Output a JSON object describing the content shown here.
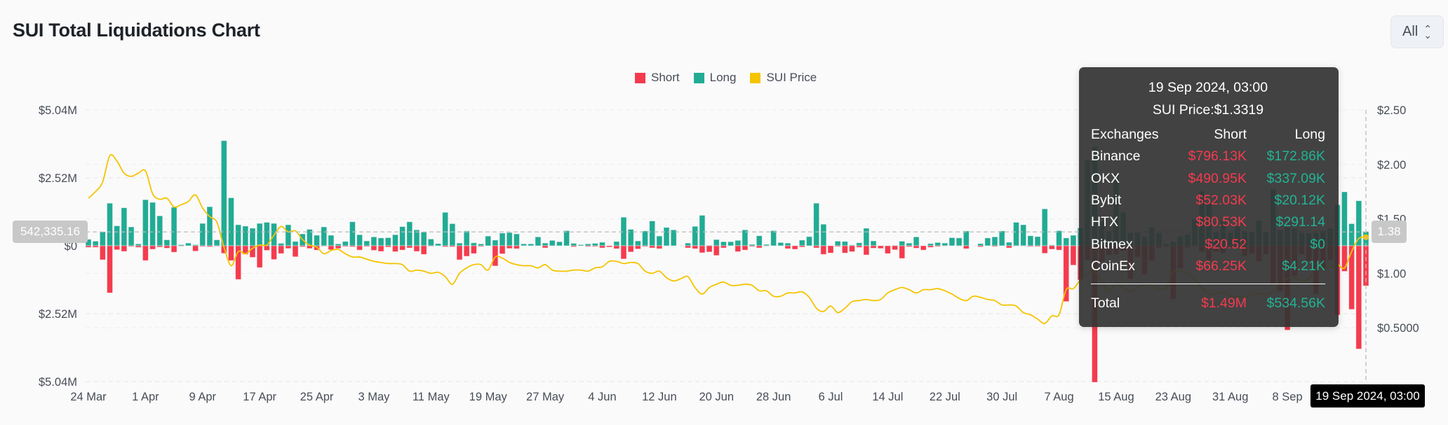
{
  "header": {
    "title": "SUI Total Liquidations Chart",
    "range_select": "All"
  },
  "legend": [
    {
      "label": "Short",
      "color": "#f43b4e"
    },
    {
      "label": "Long",
      "color": "#22ab94"
    },
    {
      "label": "SUI Price",
      "color": "#f5c400"
    }
  ],
  "tooltip": {
    "date": "19 Sep 2024, 03:00",
    "price": "SUI Price:$1.3319",
    "columns": [
      "Exchanges",
      "Short",
      "Long"
    ],
    "rows": [
      {
        "exchange": "Binance",
        "short": "$796.13K",
        "long": "$172.86K"
      },
      {
        "exchange": "OKX",
        "short": "$490.95K",
        "long": "$337.09K"
      },
      {
        "exchange": "Bybit",
        "short": "$52.03K",
        "long": "$20.12K"
      },
      {
        "exchange": "HTX",
        "short": "$80.53K",
        "long": "$291.14"
      },
      {
        "exchange": "Bitmex",
        "short": "$20.52",
        "long": "$0"
      },
      {
        "exchange": "CoinEx",
        "short": "$66.25K",
        "long": "$4.21K"
      }
    ],
    "total": {
      "label": "Total",
      "short": "$1.49M",
      "long": "$534.56K"
    }
  },
  "crosshair": {
    "left_value": "542,335.16",
    "right_value": "1.38",
    "date_label": "19 Sep 2024, 03:00"
  },
  "chart_data": {
    "type": "bar",
    "title": "SUI Total Liquidations Chart",
    "x": {
      "start": "2024-03-24",
      "end": "2024-09-19",
      "step": "1 day"
    },
    "x_tick_labels": [
      "24 Mar",
      "1 Apr",
      "9 Apr",
      "17 Apr",
      "25 Apr",
      "3 May",
      "11 May",
      "19 May",
      "27 May",
      "4 Jun",
      "12 Jun",
      "20 Jun",
      "28 Jun",
      "6 Jul",
      "14 Jul",
      "22 Jul",
      "30 Jul",
      "7 Aug",
      "15 Aug",
      "23 Aug",
      "31 Aug",
      "8 Sep"
    ],
    "y_left": {
      "unit": "USD millions",
      "range": [
        -5.04,
        5.04
      ],
      "ticks": [
        5.04,
        2.52,
        0,
        -2.52,
        -5.04
      ],
      "tick_labels": [
        "$5.04M",
        "$2.52M",
        "$0",
        "$2.52M",
        "$5.04M"
      ]
    },
    "y_right": {
      "unit": "USD",
      "range": [
        0,
        2.5
      ],
      "ticks": [
        2.5,
        2.0,
        1.5,
        1.0,
        0.5
      ],
      "tick_labels": [
        "$2.50",
        "$2.00",
        "$1.50",
        "$1.00",
        "$0.5000"
      ]
    },
    "grid": true,
    "legend_position": "top-center",
    "series": [
      {
        "name": "Short",
        "type": "bar",
        "direction": "down",
        "color": "#f43b4e",
        "values": [
          0.06,
          0.06,
          0.52,
          1.75,
          0.15,
          0.21,
          0.03,
          0.06,
          0.55,
          0.13,
          0.05,
          0.09,
          0.24,
          0.02,
          0.0,
          0.2,
          0.03,
          0.04,
          0.02,
          0.28,
          0.55,
          1.25,
          0.32,
          0.43,
          0.81,
          0.17,
          0.51,
          0.29,
          0.1,
          0.41,
          0.04,
          0.1,
          0.16,
          0.02,
          0.15,
          0.1,
          0.03,
          0.04,
          0.16,
          0.03,
          0.17,
          0.21,
          0.05,
          0.22,
          0.16,
          0.08,
          0.21,
          0.32,
          0.02,
          0.0,
          0.04,
          0.04,
          0.52,
          0.39,
          0.29,
          0.03,
          0.0,
          0.75,
          0.3,
          0.1,
          0.11,
          0.0,
          0.0,
          0.0,
          0.08,
          0.0,
          0.0,
          0.0,
          0.04,
          0.0,
          0.03,
          0.03,
          0.08,
          0.05,
          0.11,
          0.49,
          0.23,
          0.12,
          0.03,
          0.08,
          0.11,
          0.0,
          0.0,
          0.0,
          0.08,
          0.11,
          0.26,
          0.23,
          0.36,
          0.08,
          0.0,
          0.22,
          0.16,
          0.03,
          0.08,
          0.01,
          0.0,
          0.0,
          0.11,
          0.13,
          0.05,
          0.0,
          0.08,
          0.32,
          0.27,
          0.03,
          0.27,
          0.22,
          0.06,
          0.34,
          0.09,
          0.1,
          0.29,
          0.15,
          0.47,
          0.04,
          0.09,
          0.16,
          0.06,
          0.03,
          0.01,
          0.0,
          0.01,
          0.11,
          0.0,
          0.04,
          0.0,
          0.03,
          0.0,
          0.08,
          0.01,
          0.01,
          0.03,
          0.03,
          0.28,
          0.13,
          0.16,
          2.07,
          0.72,
          1.27,
          0.54,
          5.3,
          0.6,
          0.35,
          0.32,
          0.19,
          1.23,
          0.42,
          1.06,
          0.56,
          0.08,
          0.04,
          1.98,
          0.84,
          0.06,
          0.0,
          0.23,
          0.54,
          0.23,
          0.28,
          0.06,
          0.06,
          0.38,
          0.3,
          0.58,
          0.32,
          1.4,
          1.69,
          3.13,
          1.12,
          0.32,
          0.56,
          1.79,
          0.88,
          0.54,
          2.57,
          0.95,
          2.36,
          3.83,
          1.49
        ]
      },
      {
        "name": "Long",
        "type": "bar",
        "direction": "up",
        "color": "#22ab94",
        "values": [
          0.24,
          0.17,
          0.52,
          1.58,
          0.74,
          1.41,
          0.7,
          0.07,
          1.71,
          1.61,
          1.11,
          0.22,
          1.43,
          0.04,
          0.1,
          0.04,
          0.83,
          1.45,
          0.22,
          3.9,
          1.78,
          0.78,
          0.73,
          0.65,
          0.83,
          0.87,
          0.83,
          0.09,
          0.78,
          0.16,
          0.44,
          0.61,
          0.39,
          0.7,
          0.39,
          0.07,
          0.16,
          0.89,
          0.41,
          0.18,
          0.33,
          0.29,
          0.3,
          0.41,
          0.71,
          0.89,
          0.59,
          0.51,
          0.25,
          0.08,
          1.24,
          0.82,
          0.1,
          0.55,
          0.11,
          0.07,
          0.36,
          0.21,
          0.47,
          0.49,
          0.44,
          0.07,
          0.07,
          0.33,
          0.1,
          0.2,
          0.15,
          0.56,
          0.09,
          0.04,
          0.07,
          0.09,
          0.13,
          0.0,
          0.16,
          1.06,
          0.61,
          0.18,
          0.55,
          0.92,
          0.36,
          0.68,
          0.59,
          0.0,
          0.1,
          0.72,
          1.13,
          0.02,
          0.23,
          0.15,
          0.15,
          0.2,
          0.59,
          0.05,
          0.37,
          0.05,
          0.56,
          0.12,
          0.1,
          0.0,
          0.21,
          0.34,
          1.58,
          0.8,
          0.0,
          0.17,
          0.16,
          0.03,
          0.11,
          0.65,
          0.18,
          0.0,
          0.0,
          0.02,
          0.17,
          0.1,
          0.33,
          0.0,
          0.08,
          0.12,
          0.1,
          0.3,
          0.29,
          0.55,
          0.0,
          0.08,
          0.29,
          0.33,
          0.55,
          0.13,
          0.87,
          0.78,
          0.37,
          0.34,
          1.37,
          0.03,
          0.56,
          0.29,
          0.39,
          0.66,
          3.17,
          3.68,
          0.9,
          0.55,
          2.67,
          1.24,
          0.48,
          0.5,
          0.33,
          0.69,
          0.48,
          0.07,
          0.16,
          0.35,
          0.42,
          0.98,
          2.02,
          1.58,
          0.5,
          0.94,
          0.48,
          0.72,
          0.55,
          0.5,
          0.94,
          0.5,
          2.1,
          0.59,
          0.68,
          0.63,
          0.48,
          0.46,
          0.48,
          0.56,
          0.65,
          1.52,
          2.0,
          0.82,
          1.67,
          0.53
        ]
      },
      {
        "name": "SUI Price",
        "type": "line",
        "axis": "right",
        "color": "#f5c400",
        "values": [
          1.69,
          1.75,
          1.84,
          2.08,
          2.03,
          1.92,
          1.89,
          1.92,
          1.94,
          1.73,
          1.68,
          1.69,
          1.61,
          1.63,
          1.66,
          1.72,
          1.6,
          1.52,
          1.47,
          1.24,
          1.07,
          1.2,
          1.18,
          1.23,
          1.26,
          1.26,
          1.35,
          1.43,
          1.38,
          1.39,
          1.31,
          1.26,
          1.24,
          1.18,
          1.21,
          1.22,
          1.18,
          1.15,
          1.15,
          1.13,
          1.11,
          1.1,
          1.09,
          1.09,
          1.08,
          1.02,
          1.03,
          1.02,
          1.0,
          1.01,
          0.97,
          0.9,
          1.0,
          1.05,
          1.08,
          1.08,
          1.03,
          1.15,
          1.14,
          1.1,
          1.08,
          1.07,
          1.07,
          1.05,
          1.08,
          1.03,
          1.02,
          1.02,
          1.03,
          1.03,
          1.02,
          1.05,
          1.06,
          1.11,
          1.11,
          1.09,
          1.1,
          1.09,
          1.02,
          1.0,
          1.02,
          0.96,
          0.93,
          0.95,
          0.97,
          0.87,
          0.81,
          0.87,
          0.9,
          0.92,
          0.89,
          0.89,
          0.9,
          0.89,
          0.84,
          0.84,
          0.79,
          0.79,
          0.82,
          0.82,
          0.83,
          0.78,
          0.68,
          0.65,
          0.7,
          0.64,
          0.68,
          0.74,
          0.75,
          0.76,
          0.75,
          0.76,
          0.82,
          0.85,
          0.87,
          0.85,
          0.82,
          0.85,
          0.85,
          0.86,
          0.84,
          0.81,
          0.77,
          0.75,
          0.79,
          0.78,
          0.76,
          0.75,
          0.71,
          0.71,
          0.7,
          0.64,
          0.62,
          0.58,
          0.54,
          0.61,
          0.62,
          0.85,
          0.86,
          0.94,
          1.0,
          1.02,
          0.92,
          0.84,
          0.91,
          0.87,
          0.83,
          0.87,
          0.9,
          0.89,
          0.86,
          0.87,
          1.01,
          1.02,
          1.0,
          0.95,
          0.87,
          0.81,
          0.81,
          0.83,
          0.79,
          0.79,
          0.78,
          0.81,
          0.81,
          0.81,
          0.83,
          0.9,
          0.95,
          0.96,
          0.93,
          0.95,
          1.05,
          1.05,
          1.06,
          1.08,
          1.05,
          1.2,
          1.32,
          1.3319
        ]
      }
    ]
  }
}
